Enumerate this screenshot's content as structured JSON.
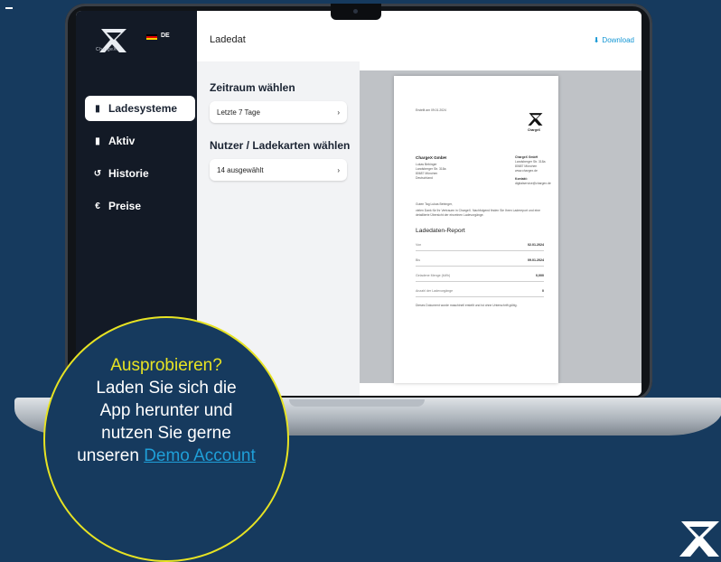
{
  "colors": {
    "background": "#163a5e",
    "accent_yellow": "#e7e323",
    "link_blue": "#1f9fd8",
    "sidebar": "#131a26"
  },
  "brand": {
    "name": "ChargeX",
    "logo_icon": "chargex-logo-icon"
  },
  "sidebar": {
    "language": "DE",
    "items": [
      {
        "label": "Ladesysteme",
        "icon": "charger-icon",
        "active": true
      },
      {
        "label": "Aktiv",
        "icon": "charger-icon",
        "active": false
      },
      {
        "label": "Historie",
        "icon": "history-icon",
        "active": false
      },
      {
        "label": "Preise",
        "icon": "euro-icon",
        "active": false
      }
    ]
  },
  "header": {
    "title": "Ladedat",
    "download_label": "Download"
  },
  "filters": {
    "period_title": "Zeitraum wählen",
    "period_value": "Letzte 7 Tage",
    "users_title": "Nutzer / Ladekarten wählen",
    "users_value": "14 ausgewählt"
  },
  "report": {
    "created": "Erstellt am 09.01.2024",
    "company_name": "ChargeX GmbH",
    "address": [
      "Lukas Bebinger",
      "Landsberger Str. 318a",
      "80687 München",
      "Deutschland"
    ],
    "sender": [
      "ChargeX GmbH",
      "Landsberger Str. 318a",
      "80687 München",
      "www.chargex.de"
    ],
    "contact_label": "Kontakt:",
    "contact_email": "digitalservice@chargex.de",
    "greeting": "Guten Tag Lukas Bebinger,",
    "intro": "vielen Dank für Ihr Vertrauen in ChargeX. Nachfolgend finden Sie Ihren Ladereport und eine detaillierte Übersicht der einzelnen Ladevorgänge.",
    "title": "Ladedaten-Report",
    "rows": [
      {
        "label": "Von",
        "value": "02.01.2024"
      },
      {
        "label": "Bis",
        "value": "09.01.2024"
      },
      {
        "label": "Geladene Menge (kWh)",
        "value": "0,000"
      },
      {
        "label": "Anzahl der Ladevorgänge",
        "value": "0"
      }
    ],
    "footnote": "Dieses Dokument wurde maschinell erstellt und ist ohne Unterschrift gültig."
  },
  "overlay": {
    "title": "Ausprobieren?",
    "line1": "Laden Sie sich die",
    "line2": "App herunter und",
    "line3": "nutzen Sie gerne",
    "line4_prefix": "unseren ",
    "link_text": "Demo Account"
  }
}
